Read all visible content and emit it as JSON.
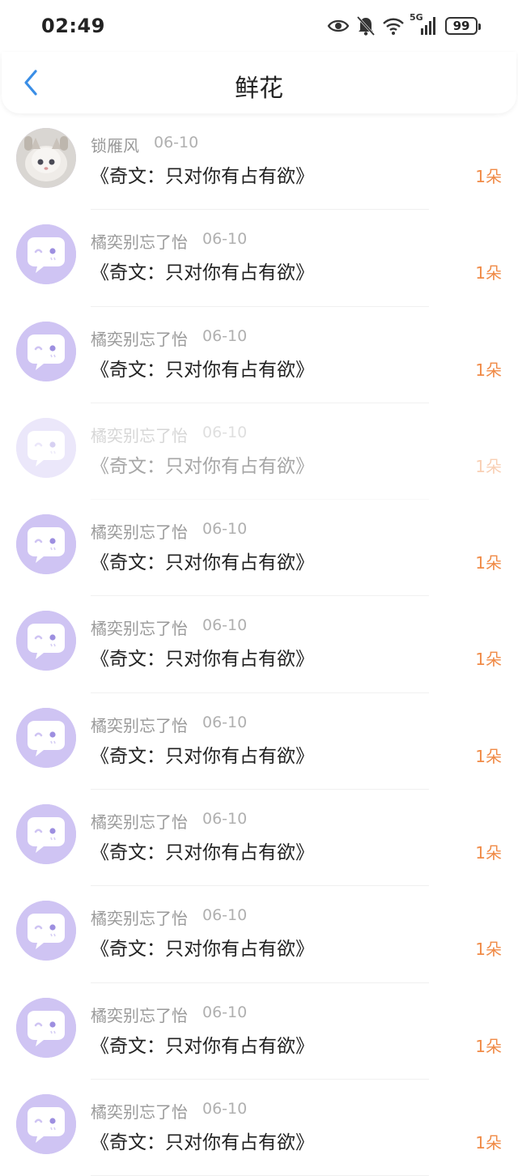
{
  "status_bar": {
    "time": "02:49",
    "network": "5G",
    "battery": "99",
    "icons": [
      "eye-icon",
      "bell-muted-icon",
      "wifi-icon",
      "signal-icon",
      "battery-icon"
    ]
  },
  "header": {
    "title": "鲜花",
    "back_icon": "chevron-left-icon"
  },
  "colors": {
    "accent_blue": "#3a8ee6",
    "count_orange": "#f08a46",
    "avatar_purple": "#cfc4f3"
  },
  "rows": [
    {
      "name": "锁雁风",
      "date": "06-10",
      "book": "《奇文：只对你有占有欲》",
      "count": "1朵",
      "avatar": "cat-photo-avatar"
    },
    {
      "name": "橘奕别忘了怡",
      "date": "06-10",
      "book": "《奇文：只对你有占有欲》",
      "count": "1朵",
      "avatar": "default-chat-avatar"
    },
    {
      "name": "橘奕别忘了怡",
      "date": "06-10",
      "book": "《奇文：只对你有占有欲》",
      "count": "1朵",
      "avatar": "default-chat-avatar"
    },
    {
      "name": "橘奕别忘了怡",
      "date": "06-10",
      "book": "《奇文：只对你有占有欲》",
      "count": "1朵",
      "avatar": "default-chat-avatar"
    },
    {
      "name": "橘奕别忘了怡",
      "date": "06-10",
      "book": "《奇文：只对你有占有欲》",
      "count": "1朵",
      "avatar": "default-chat-avatar"
    },
    {
      "name": "橘奕别忘了怡",
      "date": "06-10",
      "book": "《奇文：只对你有占有欲》",
      "count": "1朵",
      "avatar": "default-chat-avatar"
    },
    {
      "name": "橘奕别忘了怡",
      "date": "06-10",
      "book": "《奇文：只对你有占有欲》",
      "count": "1朵",
      "avatar": "default-chat-avatar"
    },
    {
      "name": "橘奕别忘了怡",
      "date": "06-10",
      "book": "《奇文：只对你有占有欲》",
      "count": "1朵",
      "avatar": "default-chat-avatar"
    },
    {
      "name": "橘奕别忘了怡",
      "date": "06-10",
      "book": "《奇文：只对你有占有欲》",
      "count": "1朵",
      "avatar": "default-chat-avatar"
    },
    {
      "name": "橘奕别忘了怡",
      "date": "06-10",
      "book": "《奇文：只对你有占有欲》",
      "count": "1朵",
      "avatar": "default-chat-avatar"
    },
    {
      "name": "橘奕别忘了怡",
      "date": "06-10",
      "book": "《奇文：只对你有占有欲》",
      "count": "1朵",
      "avatar": "default-chat-avatar"
    }
  ]
}
